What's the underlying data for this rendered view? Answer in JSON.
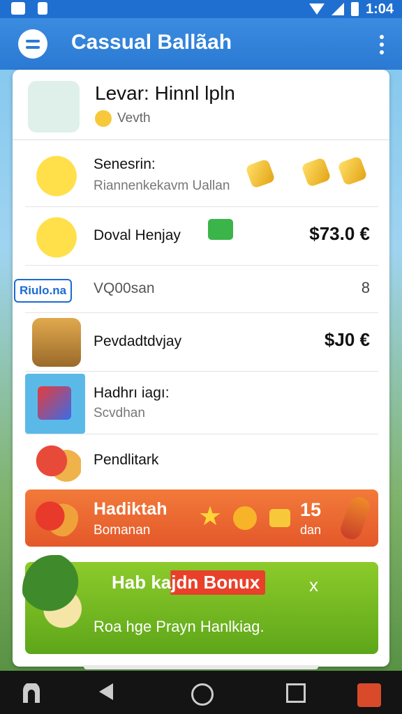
{
  "status_bar": {
    "time": "1:04"
  },
  "app_bar": {
    "title": "Cassual Ballãah"
  },
  "header": {
    "title": "Levar: Hinnl lpln",
    "subtitle": "Vevth"
  },
  "rows": [
    {
      "label": "Senesrin:",
      "sublabel": "Riannenkekavm Uallan",
      "icon": "chick-icon"
    },
    {
      "label": "Doval Henjay",
      "price": "$73.0 €",
      "icon": "chick-bow-icon"
    },
    {
      "label": "VQ00san",
      "badge": "Riulo.na",
      "trailing": "8"
    },
    {
      "label": "Pevdadtdvjay",
      "price": "$J0 €",
      "icon": "treasure-chest-icon"
    },
    {
      "label": "Hadhrı iagı:",
      "sublabel": "Scvdhan",
      "icon": "cube-icon"
    },
    {
      "label": "Pendlitark",
      "icon": "rolls-icon"
    }
  ],
  "promo": {
    "title": "Hadiktah",
    "subtitle": "Bomanan",
    "count": "15",
    "count_unit": "dan"
  },
  "bonus": {
    "title": "Hab kajdn Bonux",
    "close": "x",
    "description": "Roa hge Prayn Hanlkiag."
  },
  "colors": {
    "app_bar": "#2a7ad4",
    "promo": "#e4582a",
    "bonus": "#6fb41f"
  }
}
